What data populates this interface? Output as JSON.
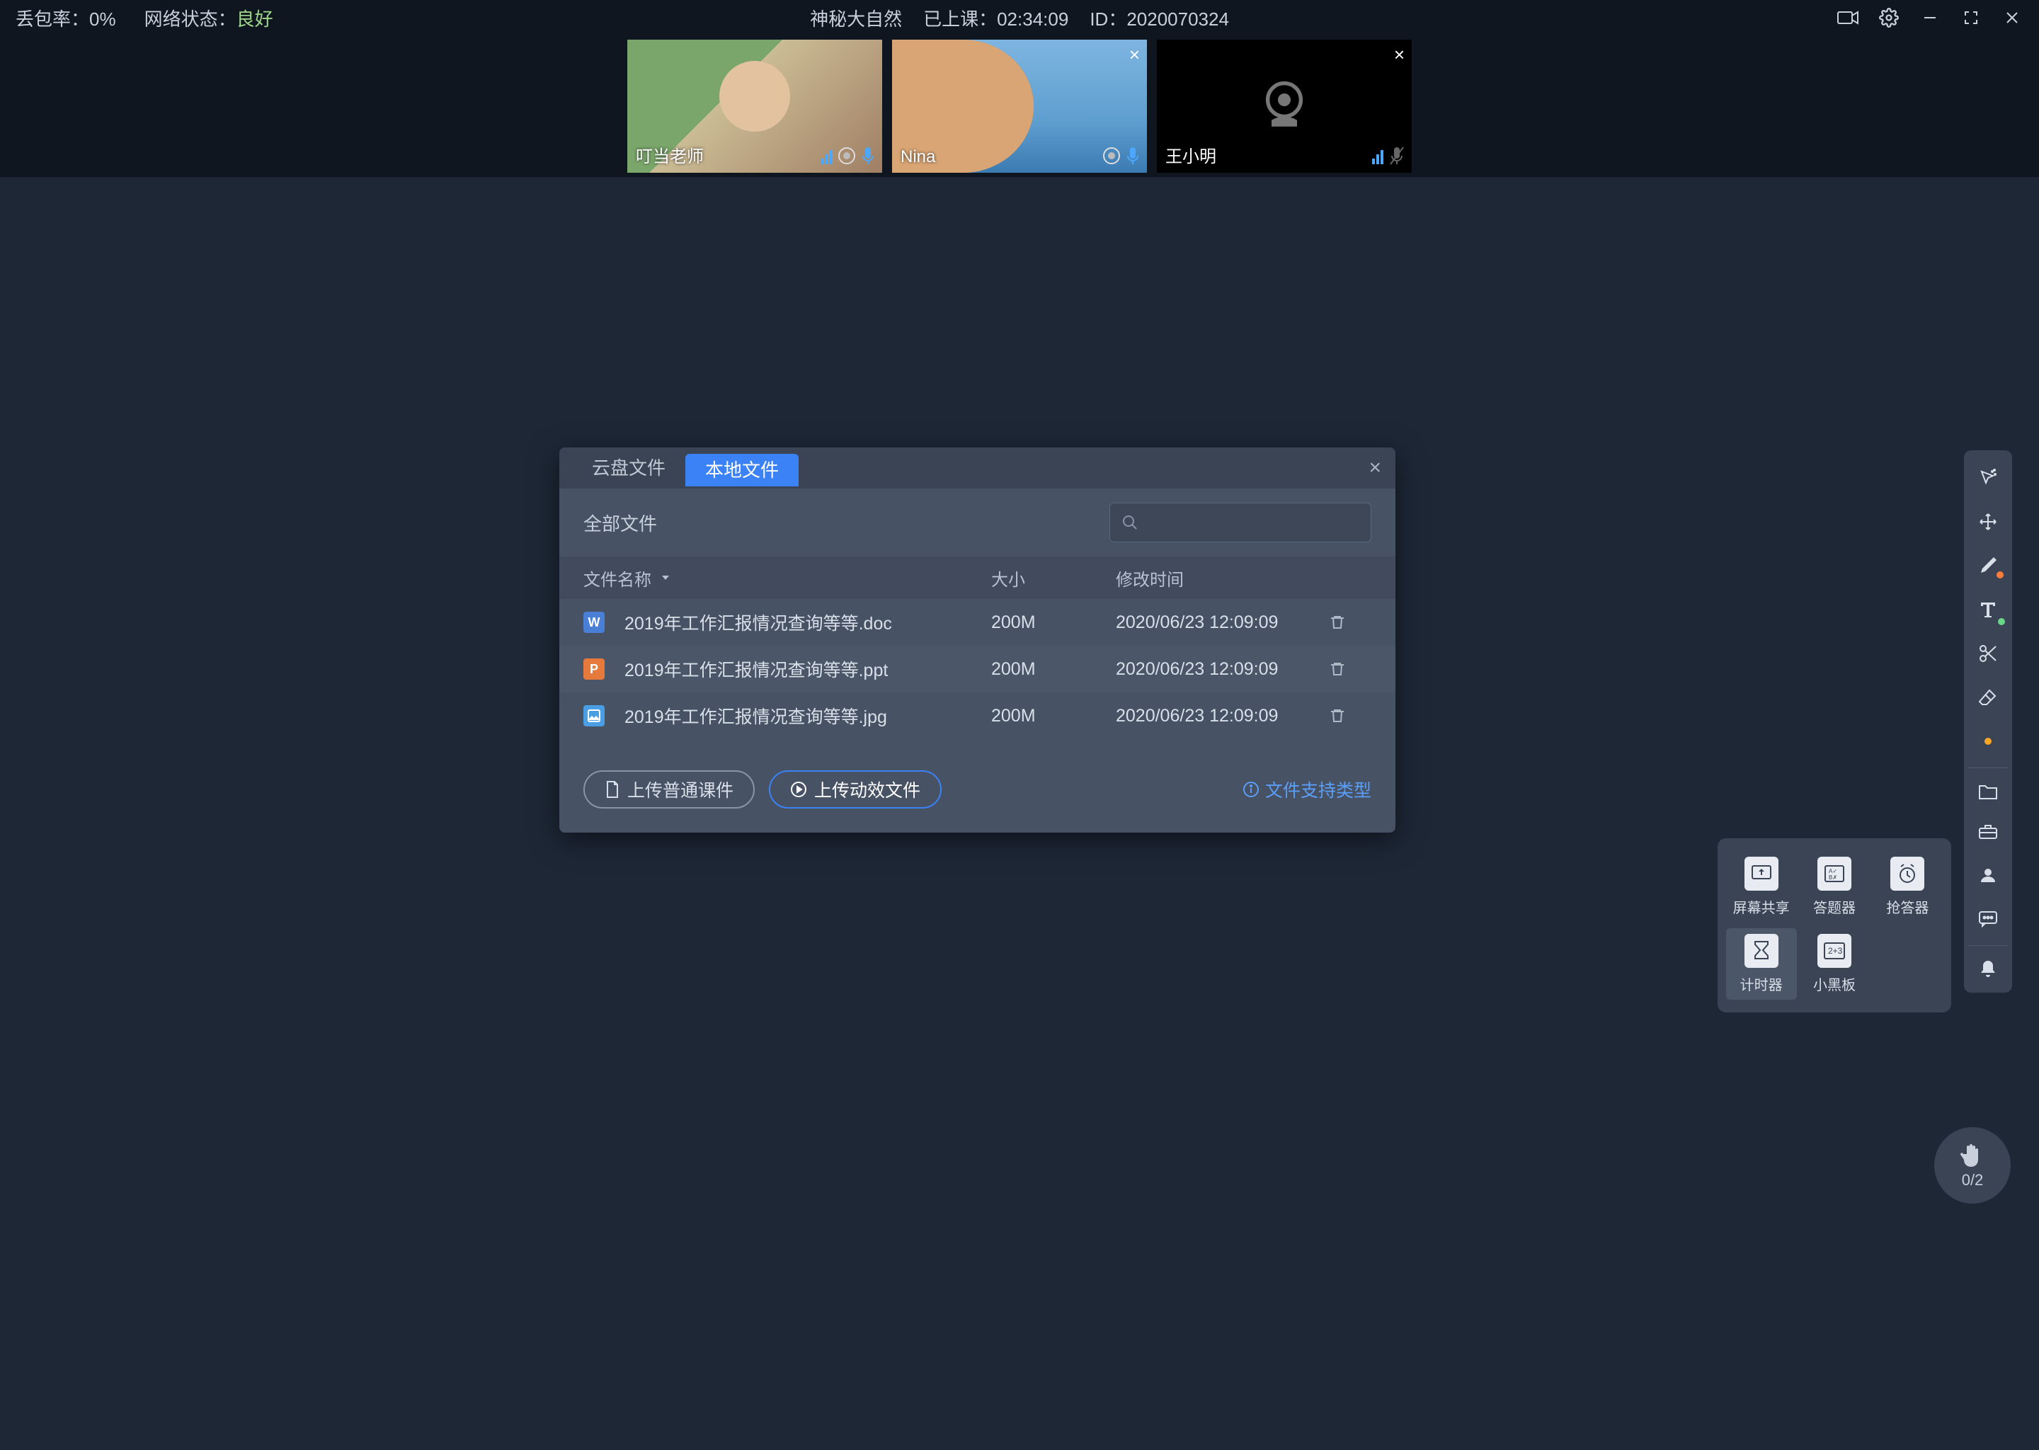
{
  "topbar": {
    "packetLossLabel": "丢包率：",
    "packetLossValue": "0%",
    "netLabel": "网络状态：",
    "netValue": "良好",
    "title": "神秘大自然",
    "elapsedLabel": "已上课：",
    "elapsedValue": "02:34:09",
    "idLabel": "ID：",
    "idValue": "2020070324"
  },
  "videos": [
    {
      "name": "叮当老师",
      "micMuted": false,
      "camOn": true
    },
    {
      "name": "Nina",
      "micMuted": false,
      "camOn": true,
      "closable": true
    },
    {
      "name": "王小明",
      "micMuted": true,
      "camOn": false,
      "closable": true
    }
  ],
  "modal": {
    "tabs": {
      "cloud": "云盘文件",
      "local": "本地文件"
    },
    "allFiles": "全部文件",
    "headers": {
      "name": "文件名称",
      "size": "大小",
      "time": "修改时间"
    },
    "rows": [
      {
        "icon": "doc",
        "letter": "W",
        "name": "2019年工作汇报情况查询等等.doc",
        "size": "200M",
        "time": "2020/06/23 12:09:09"
      },
      {
        "icon": "ppt",
        "letter": "P",
        "name": "2019年工作汇报情况查询等等.ppt",
        "size": "200M",
        "time": "2020/06/23 12:09:09"
      },
      {
        "icon": "jpg",
        "letter": "▲",
        "name": "2019年工作汇报情况查询等等.jpg",
        "size": "200M",
        "time": "2020/06/23 12:09:09"
      }
    ],
    "uploadNormal": "上传普通课件",
    "uploadAnimated": "上传动效文件",
    "supportTypes": "文件支持类型"
  },
  "toolsPopup": {
    "screenShare": "屏幕共享",
    "answerDevice": "答题器",
    "buzzer": "抢答器",
    "timer": "计时器",
    "blackboard": "小黑板"
  },
  "raiseHand": {
    "count": "0/2"
  }
}
